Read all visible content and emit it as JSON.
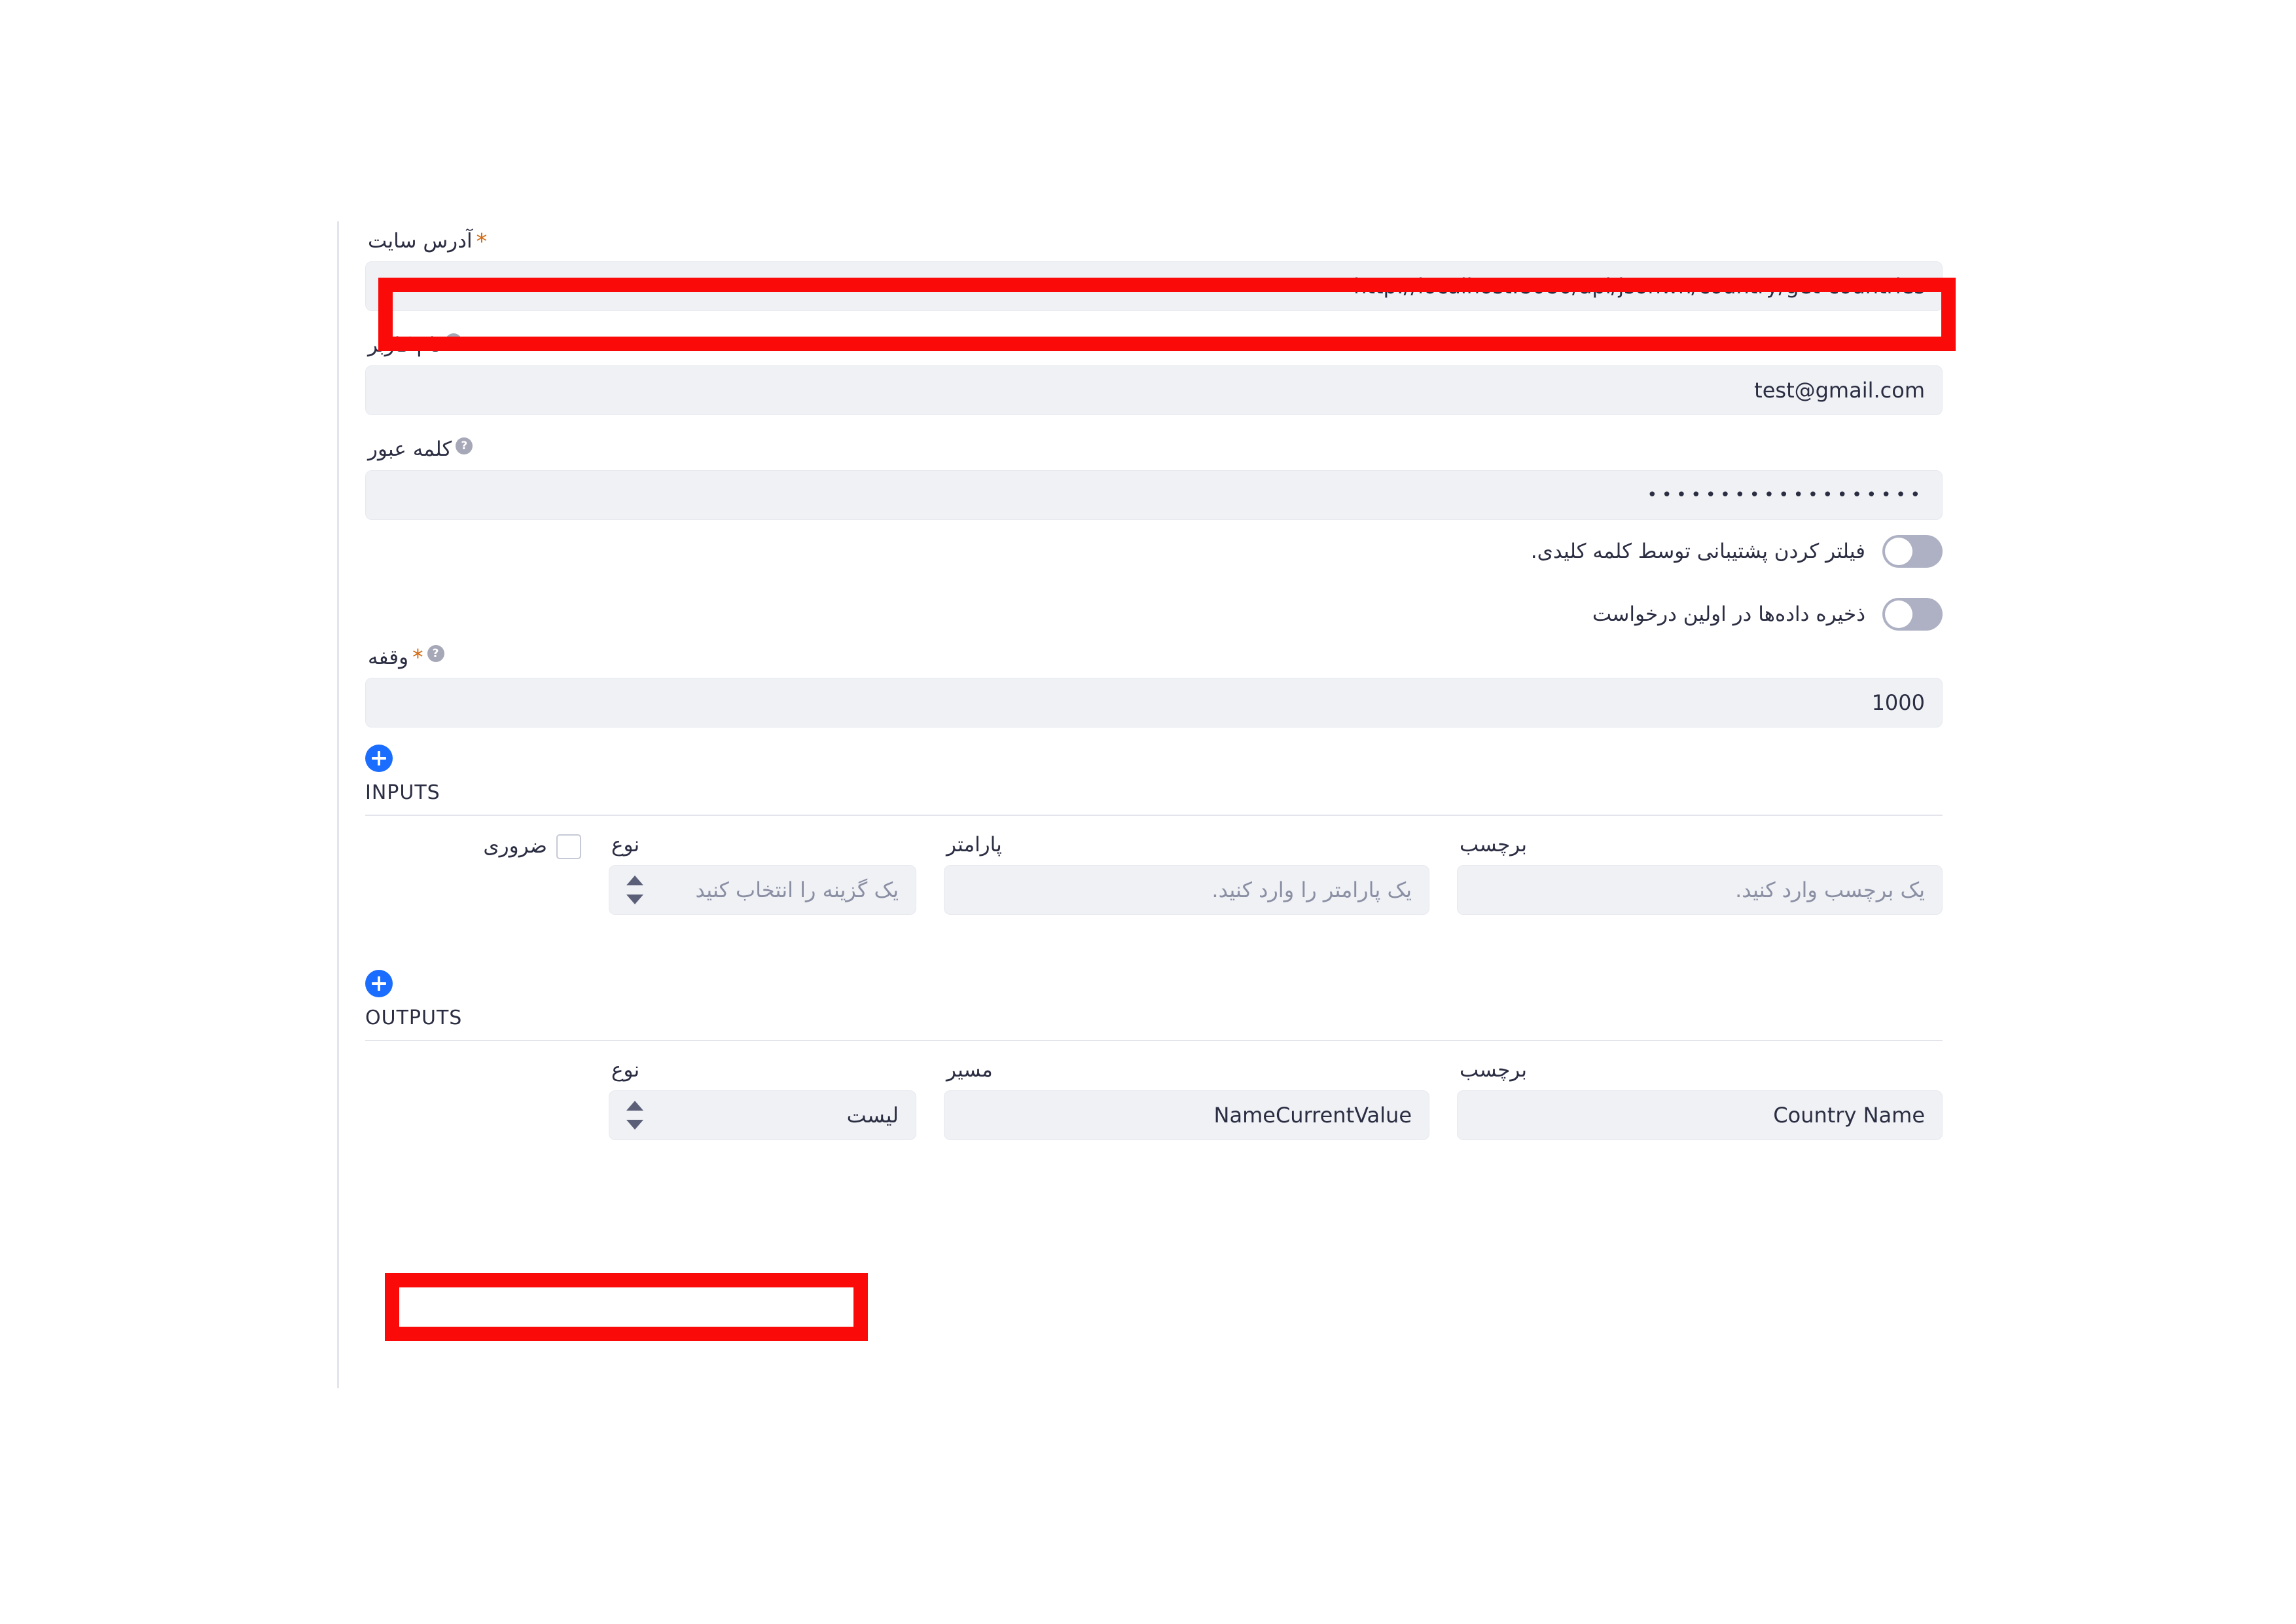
{
  "form": {
    "site_url": {
      "label": "آدرس سایت",
      "required_marker": "*",
      "value": "http://localhost:8080/api/jsonwn/country/get-countries"
    },
    "username": {
      "label": "نام کاربر",
      "help_icon": "question-mark-icon",
      "value": "test@gmail.com"
    },
    "password": {
      "label": "کلمه عبور",
      "help_icon": "question-mark-icon",
      "value": "•••••••••••••••••••"
    },
    "toggles": [
      {
        "label": "فیلتر کردن پشتیبانی توسط کلمه کلیدی.",
        "state": "on"
      },
      {
        "label": "ذخیره داده‌ها در اولین درخواست",
        "state": "on"
      }
    ],
    "timeout": {
      "label": "وقفه",
      "required_marker": "*",
      "help_icon": "question-mark-icon",
      "value": "1000"
    }
  },
  "inputs_section": {
    "title": "INPUTS",
    "add_button": "plus-icon",
    "columns": {
      "label": "برچسب",
      "parameter": "پارامتر",
      "type": "نوع",
      "required": "ضروری"
    },
    "row": {
      "label_placeholder": "یک برچسب وارد کنید.",
      "label_value": "",
      "parameter_placeholder": "یک پارامتر را وارد کنید.",
      "parameter_value": "",
      "type_placeholder": "یک گزینه را انتخاب کنید",
      "type_value": "",
      "required_checked": false
    }
  },
  "outputs_section": {
    "title": "OUTPUTS",
    "add_button": "plus-icon",
    "columns": {
      "label": "برچسب",
      "path": "مسیر",
      "type": "نوع"
    },
    "row": {
      "label_value": "Country Name",
      "path_value": "NameCurrentValue",
      "type_value": "لیست"
    }
  },
  "colors": {
    "accent": "#1a6dff",
    "field_bg": "#eff1f5",
    "highlight": "#fb0a0a",
    "toggle_on": "#aeb1c4",
    "required_star": "#d4690f",
    "text": "#2b2d42"
  }
}
